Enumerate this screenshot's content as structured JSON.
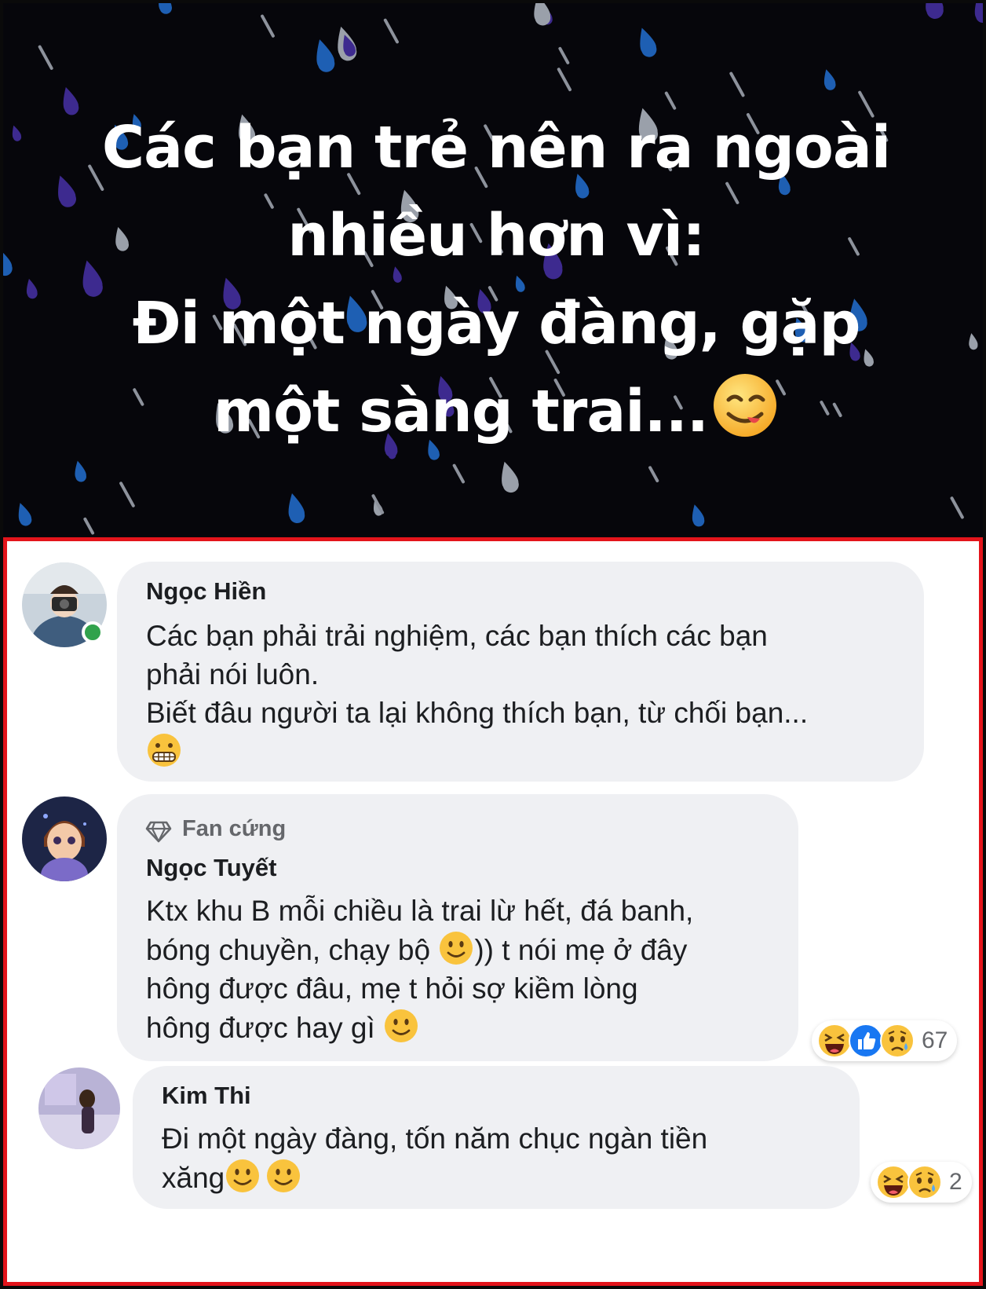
{
  "post": {
    "lines": [
      "Các bạn trẻ nên ra ngoài",
      "nhiều hơn vì:",
      "Đi một ngày đàng, gặp",
      "một sàng trai..."
    ],
    "trailing_emoji": "face-savoring-food",
    "background_color": "#06060b",
    "drop_colors": [
      "#3d2a8f",
      "#1e5fb3",
      "#9aa0aa"
    ]
  },
  "highlight_border_color": "#e3141b",
  "comments": [
    {
      "author": "Ngọc Hiền",
      "online": true,
      "lines": [
        "Các bạn phải trải nghiệm, các bạn thích các bạn",
        "phải nói luôn.",
        "Biết đâu người ta lại không thích bạn, từ chối bạn..."
      ],
      "emoji": "grimacing-face"
    },
    {
      "badge": "Fan cứng",
      "badge_icon": "diamond-icon",
      "author": "Ngọc Tuyết",
      "lines": [
        "Ktx khu B mỗi chiều là trai lừ hết, đá banh,",
        "bóng chuyền, chạy bộ",
        ")) t nói mẹ ở đây",
        "hông được đâu, mẹ t hỏi sợ kiềm lòng",
        "hông được hay gì"
      ],
      "reactions": {
        "icons": [
          "haha-icon",
          "like-icon",
          "sad-icon"
        ],
        "count": "67"
      }
    },
    {
      "author": "Kim Thi",
      "lines": [
        "Đi một ngày đàng, tốn năm chục ngàn tiền",
        "xăng"
      ],
      "reactions": {
        "icons": [
          "haha-icon",
          "sad-icon"
        ],
        "count": "2"
      }
    }
  ]
}
